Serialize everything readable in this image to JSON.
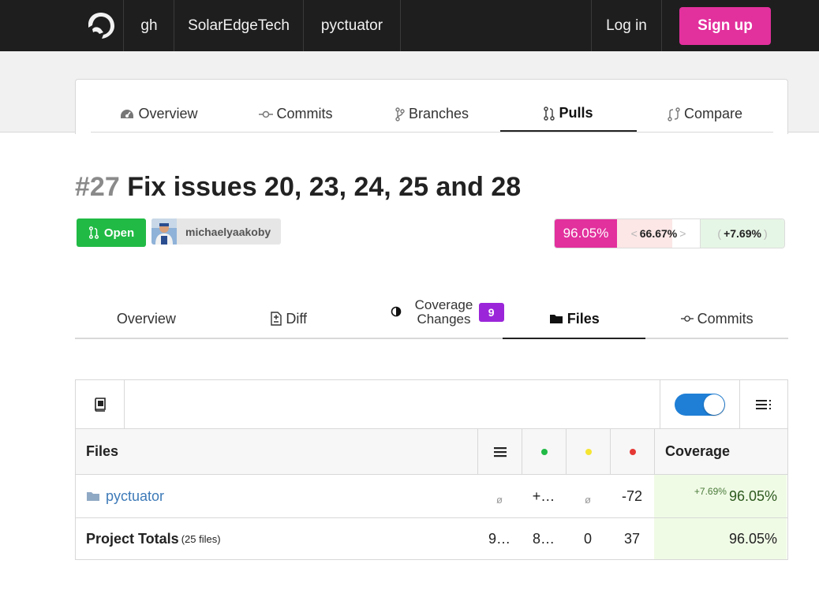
{
  "nav": {
    "crumbs": [
      "gh",
      "SolarEdgeTech",
      "pyctuator"
    ],
    "login": "Log in",
    "signup": "Sign up",
    "signup_color": "#e2309d"
  },
  "repo_tabs": [
    {
      "label": "Overview",
      "icon": "dashboard-icon"
    },
    {
      "label": "Commits",
      "icon": "commit-icon"
    },
    {
      "label": "Branches",
      "icon": "branch-icon"
    },
    {
      "label": "Pulls",
      "icon": "pull-request-icon",
      "active": true
    },
    {
      "label": "Compare",
      "icon": "compare-icon"
    }
  ],
  "pull": {
    "number": "#27",
    "title": "Fix issues 20, 23, 24, 25 and 28",
    "state": "Open",
    "author": "michaelyaakoby",
    "coverage": "96.05%",
    "base_coverage": "66.67%",
    "coverage_change": "+7.69%"
  },
  "pull_tabs": {
    "overview": "Overview",
    "diff": "Diff",
    "coverage_changes_line1": "Coverage",
    "coverage_changes_line2": "Changes",
    "coverage_changes_count": "9",
    "files": "Files",
    "commits": "Commits"
  },
  "table": {
    "headers": {
      "files": "Files",
      "coverage": "Coverage"
    },
    "dot_colors": [
      "#21ba45",
      "#f5e532",
      "#e53935"
    ],
    "rows": [
      {
        "name": "pyctuator",
        "lines": "ø",
        "hits": "+…",
        "partial": "ø",
        "misses": "-72",
        "delta": "+7.69%",
        "coverage": "96.05%"
      }
    ],
    "totals": {
      "label": "Project Totals",
      "files": "(25 files)",
      "lines": "9…",
      "hits": "8…",
      "partial": "0",
      "misses": "37",
      "coverage": "96.05%"
    }
  }
}
